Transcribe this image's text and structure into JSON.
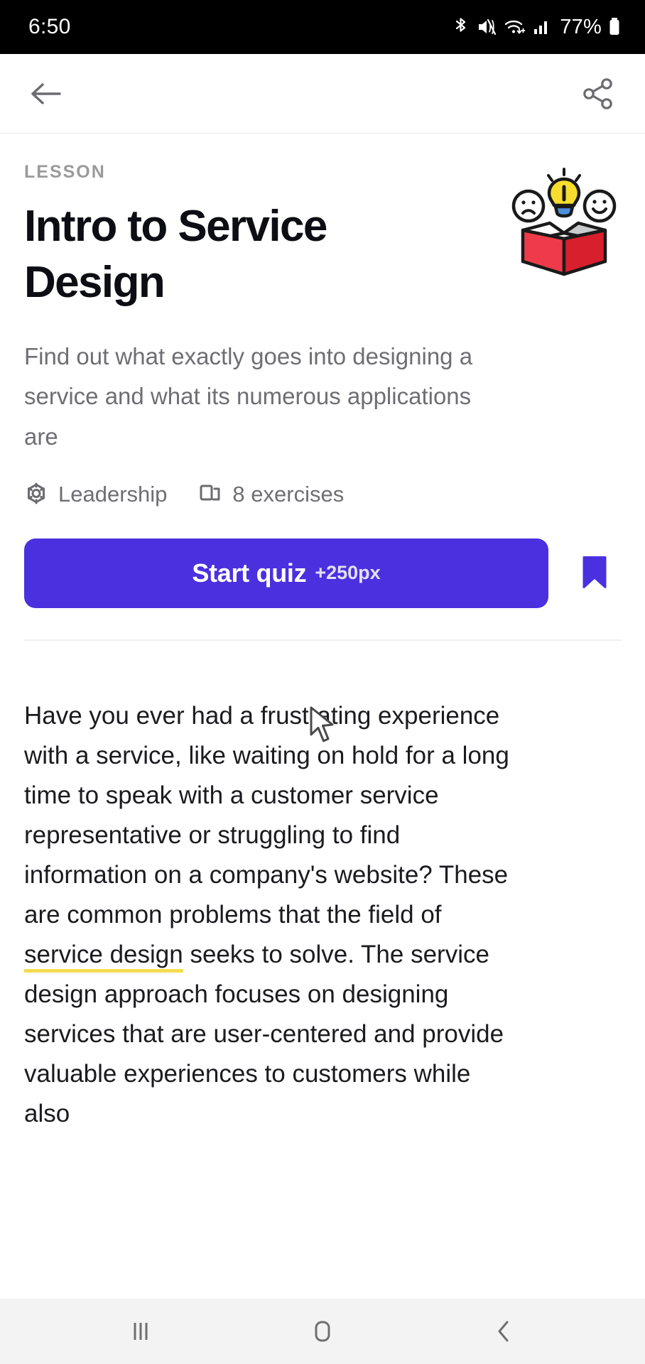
{
  "status_bar": {
    "time": "6:50",
    "battery_percent": "77%",
    "icons": [
      "bluetooth-icon",
      "mute-icon",
      "wifi-icon",
      "cellular-signal-icon",
      "battery-icon"
    ]
  },
  "app_bar": {
    "back_icon": "back-arrow-icon",
    "share_icon": "share-icon"
  },
  "lesson": {
    "eyebrow": "LESSON",
    "title": "Intro to Service Design",
    "description": "Find out what exactly goes into designing a service and what its numerous applications are",
    "illustration": "idea-box-illustration",
    "meta": [
      {
        "icon": "category-gear-icon",
        "label": "Leadership"
      },
      {
        "icon": "exercises-cards-icon",
        "label": "8 exercises"
      }
    ],
    "cta": {
      "label": "Start quiz",
      "points": "+250px",
      "color": "#4b30e0"
    },
    "bookmark": {
      "icon": "bookmark-filled-icon",
      "color": "#4b30e0"
    }
  },
  "article": {
    "paragraph_before_link": "Have you ever had a frustrating experience with a service, like waiting on hold for a long time to speak with a customer service representative or struggling to find information on a company's website? These are common problems that the field of ",
    "link_text": "service design",
    "paragraph_after_link": " seeks to solve. The service design approach focuses on designing services that are user-centered and provide valuable experiences to customers while also",
    "highlight_color": "#f2dd52"
  },
  "nav_bar": {
    "recents_icon": "recents-icon",
    "home_icon": "home-icon",
    "back_icon": "nav-back-icon"
  }
}
